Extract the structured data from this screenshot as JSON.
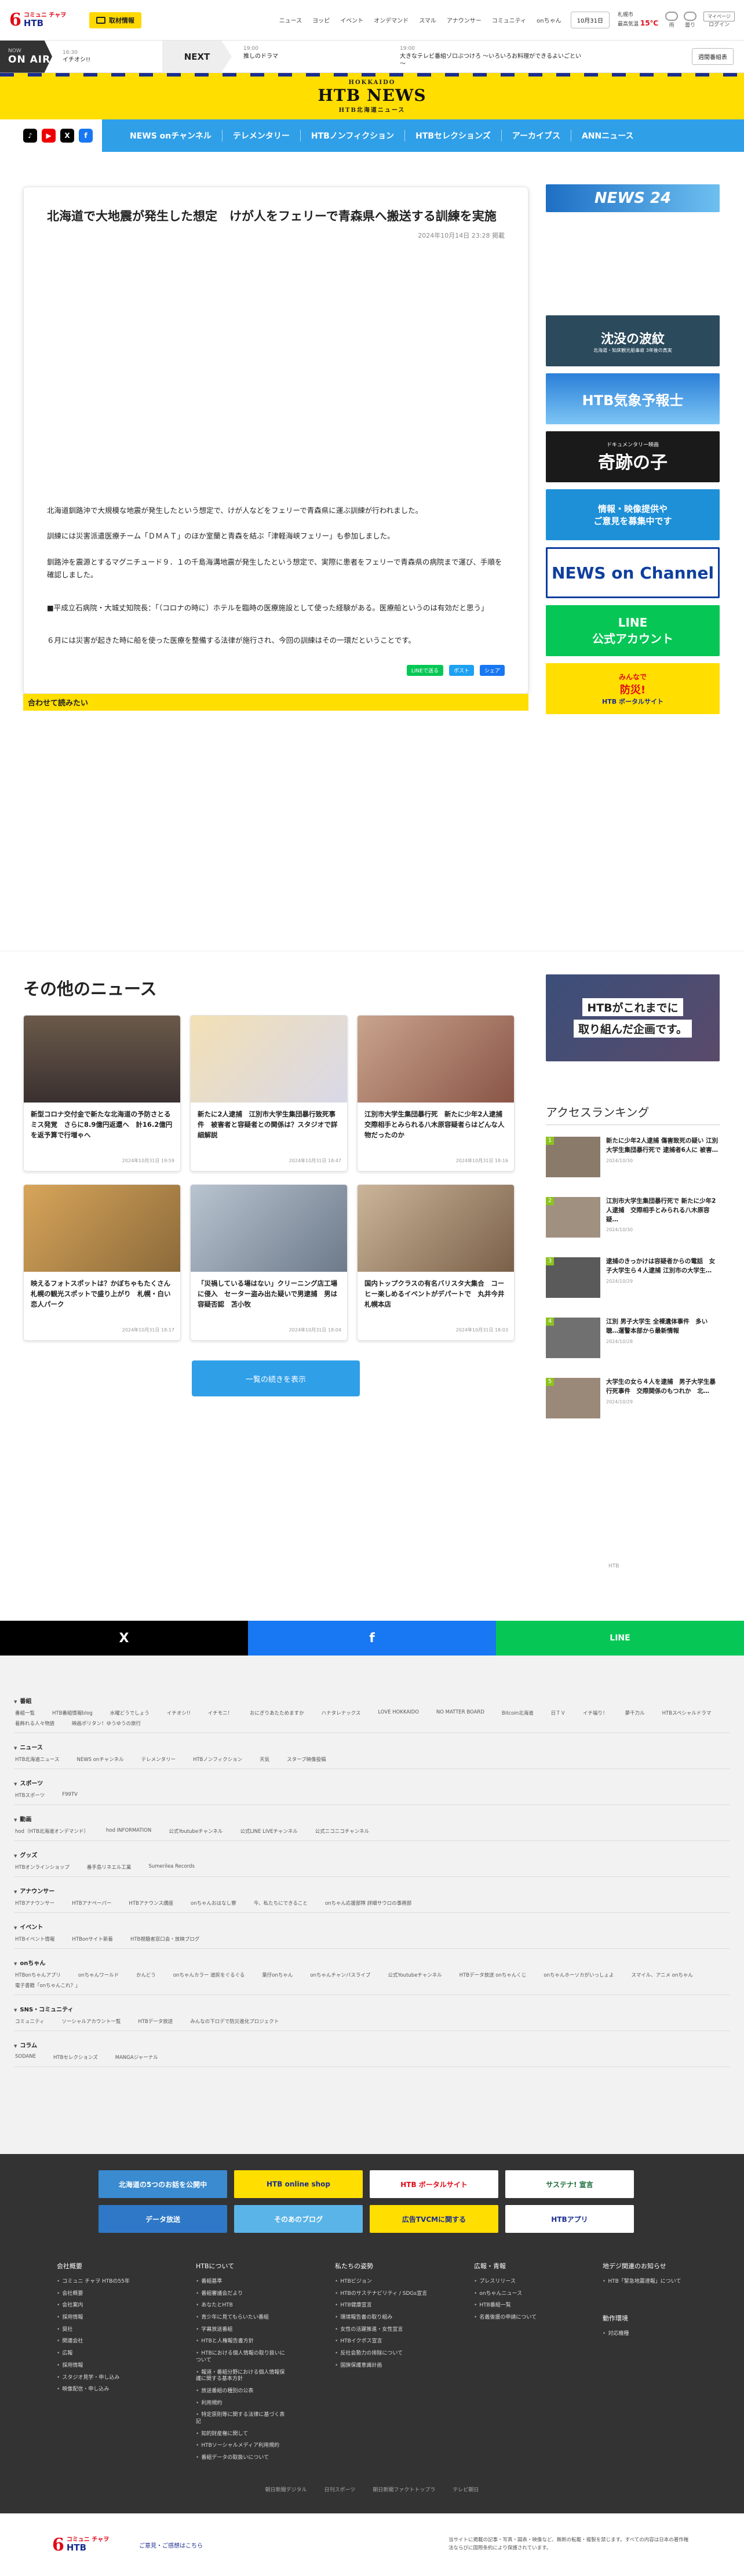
{
  "header": {
    "logo_small": "コミュニ チャヲ",
    "logo_brand": "HTB",
    "inspect_label": "取材情報",
    "nav": [
      "ニュース",
      "ヨッピ",
      "イベント",
      "オンデマンド",
      "スマル",
      "アナウンサー",
      "コミュニティ",
      "onちゃん"
    ],
    "date": "10月31日",
    "weather_city": "札幌市",
    "weather_label": "最高気温",
    "weather_temp": "15℃",
    "weather_cat1": "雨",
    "weather_cat2": "曇り",
    "login": "ログイン",
    "login_btn": "マイページ",
    "login_sub": "ログイン"
  },
  "onair": {
    "label_small": "NOW",
    "label": "ON AIR",
    "now_time": "16:30",
    "now_title": "イチオシ!!",
    "next_label": "NEXT",
    "next1_time": "19:00",
    "next1_title": "推しのドラマ",
    "next2_time": "19:00",
    "next2_title": "大きなテレビ番組ゾロぶつけろ ～いろいろお料理ができるよいごとい～",
    "programs_btn": "週間番組表"
  },
  "banner": {
    "small": "HOKKAIDO",
    "brand": "HTB NEWS",
    "sub": "HTB北海道ニュース"
  },
  "social_icons": [
    "tiktok-icon",
    "youtube-icon",
    "x-icon",
    "facebook-icon"
  ],
  "mainnav": [
    "NEWS onチャンネル",
    "テレメンタリー",
    "HTBノンフィクション",
    "HTBセレクションズ",
    "アーカイブス",
    "ANNニュース"
  ],
  "article": {
    "title": "北海道で大地震が発生した想定　けが人をフェリーで青森県へ搬送する訓練を実施",
    "date": "2024年10月14日 23:28 掲載",
    "paragraphs": [
      "北海道釧路沖で大規模な地震が発生したという想定で、けが人などをフェリーで青森県に運ぶ訓練が行われました。",
      "訓練には災害派遣医療チーム「ＤＭＡＴ」のほか室蘭と青森を結ぶ「津軽海峡フェリー」も参加しました。",
      "釧路沖を震源とするマグニチュード９．１の千島海溝地震が発生したという想定で、実際に患者をフェリーで青森県の病院まで運び、手順を確認しました。",
      "■平成立石病院・大城丈知院長：「（コロナの時に）ホテルを臨時の医療施設として使った経験がある。医療船というのは有効だと思う」",
      "６月には災害が起きた時に船を使った医療を整備する法律が施行され、今回の訓練はその一環だということです。"
    ],
    "share_line": "LINEで送る",
    "share_x": "ポスト",
    "share_fb": "シェア",
    "also_read": "合わせて読みたい"
  },
  "sidebar": {
    "news24": "NEWS 24",
    "banner1_title": "沈没の波紋",
    "banner1_sub": "北海道・知床観光船事故 3年後の真実",
    "banner2": "HTB気象予報士",
    "banner3_small": "ドキュメンタリー映画",
    "banner3": "奇跡の子",
    "banner4a": "情報・映像提供や",
    "banner4b": "ご意見を募集中です",
    "banner5": "NEWS on Channel",
    "banner6a": "LINE",
    "banner6b": "公式アカウント",
    "banner7a": "みんなで",
    "banner7b": "防災!",
    "banner7c": "HTB ボータルサイト",
    "banner8a": "HTBがこれまでに",
    "banner8b": "取り組んだ企画です。"
  },
  "other_news": {
    "heading": "その他のニュース",
    "items": [
      {
        "title": "新型コロナ交付金で新たな北海道の予防さとるミス発覚　さらに8.9億円返還へ　計16.2億円を返予算で行増ゃへ",
        "date": "2024年10月31日 19:59"
      },
      {
        "title": "新たに2人逮捕　江別市大学生集団暴行致死事件　被害者と容疑者との関係は？スタジオで詳細解説",
        "date": "2024年10月31日 18:47"
      },
      {
        "title": "江別市大学生集団暴行死　新たに少年2人逮捕　交際相手とみられる八木原容疑者らはどんな人物だったのか",
        "date": "2024年10月31日 18:16"
      },
      {
        "title": "映えるフォトスポットは？かぼちゃもたくさん　札幌の観光スポットで盛り上がり　札幌・白い恋人パーク",
        "date": "2024年10月31日 18:17"
      },
      {
        "title": "「災禍している場はない」クリーニング店工場に侵入　セーター盗み出た疑いで男逮捕　男は容疑否認　苫小牧",
        "date": "2024年10月31日 18:04"
      },
      {
        "title": "国内トップクラスの有名バリスタ大集合　コーヒー楽しめるイベントがデパートで　丸井今井札幌本店",
        "date": "2024年10月31日 18:03"
      }
    ],
    "more_btn": "一覧の続きを表示"
  },
  "ranking": {
    "heading": "アクセスランキング",
    "items": [
      {
        "no": "1",
        "title": "新たに少年2人逮捕 傷害致死の疑い 江別大学生集団暴行死で 逮捕者6人に 被害…",
        "date": "2024/10/30"
      },
      {
        "no": "2",
        "title": "江別市大学生集団暴行死で 新たに少年2人逮捕　交際相手とみられる八木原容疑…",
        "date": "2024/10/30"
      },
      {
        "no": "3",
        "title": "逮捕のきっかけは容疑者からの電話　女子大学生ら４人逮捕 江別市の大学生…",
        "date": "2024/10/29"
      },
      {
        "no": "4",
        "title": "江別 男子大学生 全裸遺体事件　多い聴…運警本部から最新情報",
        "date": "2024/10/28"
      },
      {
        "no": "5",
        "title": "大学生の女ら４人を逮捕　男子大学生暴行死事件　交際関係のもつれか　北…",
        "date": "2024/10/29"
      }
    ],
    "pager": "HTB"
  },
  "sharebar": {
    "x": "X",
    "fb": "f",
    "line": "LINE"
  },
  "sitemap": [
    {
      "title": "番組",
      "links": [
        "番組一覧",
        "HTB番組情報blog",
        "水曜どうでしょう",
        "イチオシ!!",
        "イチモニ！",
        "おにぎりあたためますか",
        "ハナタレナックス",
        "LOVE HOKKAIDO",
        "NO MATTER BOARD",
        "Bitcoin北海道",
        "日ＴＶ",
        "イチ福り！",
        "夢千力ル",
        "HTBスペシャルドラマ",
        "着飾れる人々物語",
        "映画ポリタン！ゆうゆうの旅行"
      ]
    },
    {
      "title": "ニュース",
      "links": [
        "HTB北海道ニュース",
        "NEWS onチャンネル",
        "テレメンタリー",
        "HTBノンフィクション",
        "天気",
        "スターブ映像投稿"
      ]
    },
    {
      "title": "スポーツ",
      "links": [
        "HTBスポーツ",
        "F99TV"
      ]
    },
    {
      "title": "動画",
      "links": [
        "hod（HTB北海道オンデマンド）",
        "hod INFORMATION",
        "公式Youtubeチャンネル",
        "公式LINE LIVEチャンネル",
        "公式ニコニコチャンネル"
      ]
    },
    {
      "title": "グッズ",
      "links": [
        "HTBオンラインショップ",
        "番手島リネエル工業",
        "Sumerilea Records"
      ]
    },
    {
      "title": "アナウンサー",
      "links": [
        "HTBアナウンサー",
        "HTBアナペーパー",
        "HTBアナウンス講座",
        "onちゃんおはなし寮",
        "今、私たちにできること",
        "onちゃん応援部隊 詳細サウロの事務部"
      ]
    },
    {
      "title": "イベント",
      "links": [
        "HTBイベント情報",
        "HTBonサイト新着",
        "HTB視聴者窓口会・放映ブログ"
      ]
    },
    {
      "title": "onちゃん",
      "links": [
        "HTBonちゃんアプリ",
        "onちゃんワールド",
        "かんどう",
        "onちゃんカラー 道民をぐるぐる",
        "葉仔onちゃん",
        "onちゃんチャンバスライブ",
        "公式Youtubeチャンネル",
        "HTBデータ放送 onちゃんくじ",
        "onちゃんホーソカがいっしょよ",
        "スマイル、アニメ onちゃん",
        "電子書籍「onちゃんこれ？」"
      ]
    },
    {
      "title": "SNS・コミュニティ",
      "links": [
        "コミュニティ",
        "ソーシャルアカウント一覧",
        "HTBデータ放送",
        "みんなの下ロデで防災進化プロジェクト"
      ]
    },
    {
      "title": "コラム",
      "links": [
        "SODANE",
        "HTBセレクションズ",
        "MANGAジャーナル"
      ]
    }
  ],
  "bottom_banners": {
    "row1": [
      "北海道の5つのお話を公開中",
      "HTB online shop",
      "HTB ボータルサイト",
      "サステナ! 宣言"
    ],
    "row2": [
      "データ放送",
      "そのあのブログ",
      "広告TVCMに関する",
      "HTBアプリ"
    ]
  },
  "footer_cols": [
    {
      "title": "会社概要",
      "items": [
        "コミュニ チャヲ HTBの55年",
        "会社概要",
        "会社案内",
        "採用情報",
        "奨社",
        "関連会社",
        "広報",
        "採用情報",
        "スタジオ見学・申し込み",
        "映像配信・申し込み"
      ]
    },
    {
      "title": "HTBについて",
      "items": [
        "番組基準",
        "番組審議会だより",
        "あなたとHTB",
        "青少年に見てもらいたい番組",
        "字幕放送番組",
        "HTBと人権報告書方針",
        "HTBにおける個人情報の取り扱いについて",
        "報道・番組分野における個人情報保護に関する基本方針",
        "放送番組の種別の公表",
        "利用規約",
        "特定原則等に関する法律に基づく表記",
        "知的財産権に関して",
        "HTBソーシャルメディア利用規約",
        "番組データの取扱いについて"
      ]
    },
    {
      "title": "私たちの姿勢",
      "items": [
        "HTBビジョン",
        "HTBのサステナビリティ / SDGs宣言",
        "HTB健康宣言",
        "環境報告書の取り組み",
        "女性の活躍推進・女性宣言",
        "HTBイクボス宣言",
        "反社会勢力の排除について",
        "国旗保護意識計画"
      ]
    },
    {
      "title": "広報・青報",
      "items": [
        "プレスリリース",
        "onちゃんニュース",
        "HTB番組一覧",
        "名義後援の申請について"
      ]
    },
    {
      "title": "地デジ関連のお知らせ",
      "items": [
        "HTB「緊急地震速報」について"
      ]
    },
    {
      "title": "動作環境",
      "items": [
        "対応機種"
      ]
    }
  ],
  "legal": [
    "朝日新聞デジタル",
    "日刊スポーツ",
    "朝日新聞ファクトトップラ",
    "テレビ朝日"
  ],
  "footer": {
    "contact": "ご意見・ご感想はこちら",
    "note": "当サイトに掲載の記事・写真・図表・映像など、無断の転載・複製を禁じます。すべての内容は日本の著作権法ならびに国際条約により保護されています。"
  },
  "colors": {
    "brand_blue": "#2f9fe8",
    "brand_yellow": "#ffde00",
    "brand_red": "#e10a17",
    "navy": "#1b2d8f"
  }
}
